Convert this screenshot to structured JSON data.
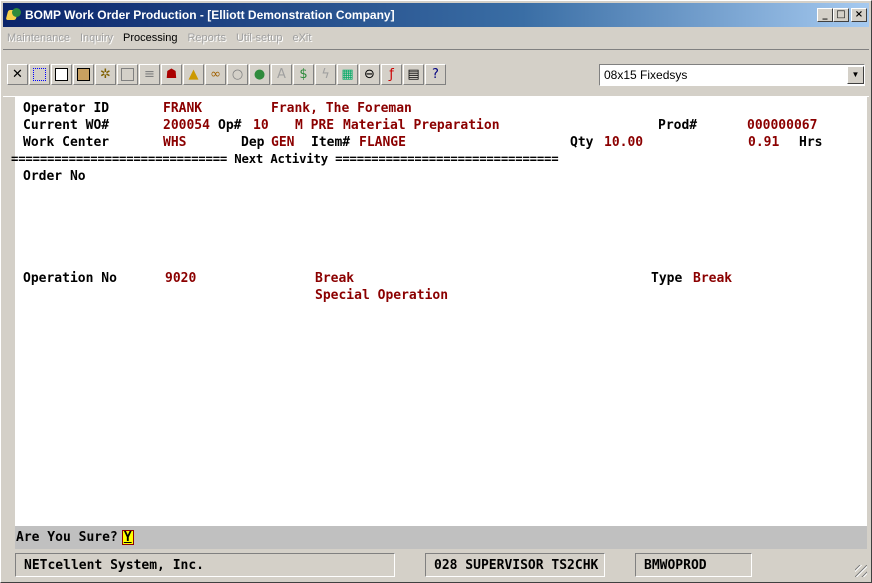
{
  "window": {
    "title": "BOMP Work Order Production - [Elliott Demonstration Company]",
    "buttons": [
      "_",
      "□",
      "×"
    ]
  },
  "menu": [
    "Maintenance",
    "Inquiry",
    "Processing",
    "Reports",
    "Util-setup",
    "eXit"
  ],
  "menu_active": "Processing",
  "toolbar": {
    "icons": [
      "delete-icon",
      "select-icon",
      "copy-icon",
      "paste-icon",
      "settings-icon",
      "document-icon",
      "list-icon",
      "user-icon",
      "alert-icon",
      "binoculars-icon",
      "search-icon",
      "app-icon",
      "text-icon",
      "money-icon",
      "lightning-icon",
      "calculator-icon",
      "link-icon",
      "function-icon",
      "notes-icon",
      "help-icon"
    ],
    "font_select": "08x15 Fixedsys"
  },
  "header": {
    "operator_id_label": "Operator ID",
    "operator_id": "FRANK",
    "operator_name": "Frank, The Foreman",
    "current_wo_label": "Current WO#",
    "current_wo": "200054",
    "op_label": "Op#",
    "op": "10",
    "op_code": "M PRE",
    "op_desc": "Material Preparation",
    "prod_label": "Prod#",
    "prod": "000000067",
    "work_center_label": "Work Center",
    "work_center": "WHS",
    "dep_label": "Dep",
    "dep": "GEN",
    "item_label": "Item#",
    "item": "FLANGE",
    "qty_label": "Qty",
    "qty": "10.00",
    "hrs_value": "0.91",
    "hrs_label": "Hrs"
  },
  "separator": "============================== Next Activity ===============================",
  "next_activity": {
    "order_no_label": "Order No",
    "operation_no_label": "Operation No",
    "operation_no": "9020",
    "operation_name": "Break",
    "operation_desc": "Special Operation",
    "type_label": "Type",
    "type": "Break"
  },
  "prompt": {
    "question": "Are You Sure?",
    "answer": "Y"
  },
  "status": {
    "company": "NETcellent System, Inc.",
    "user": "028 SUPERVISOR TS2CHK",
    "program": "BMWOPROD"
  }
}
